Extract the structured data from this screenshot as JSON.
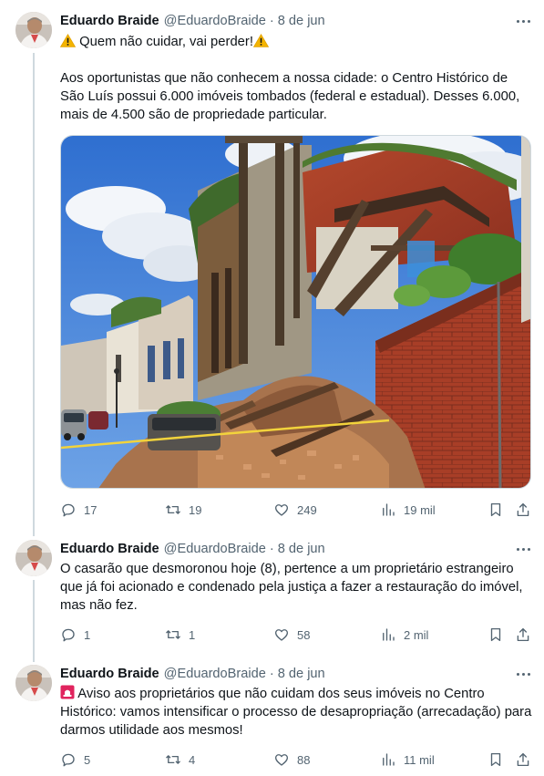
{
  "tweets": [
    {
      "author_name": "Eduardo Braide",
      "handle": "@EduardoBraide",
      "separator": "·",
      "date": "8 de jun",
      "line1": "Quem não cuidar, vai perder!",
      "line1_prefix_emoji": "⚠️",
      "line1_suffix_emoji": "⚠️",
      "paragraph2": "Aos oportunistas que não conhecem a nossa cidade: o Centro Histórico de São Luís possui 6.000 imóveis tombados (federal e estadual). Desses 6.000, mais de 4.500 são de propriedade particular.",
      "stats": {
        "replies": "17",
        "retweets": "19",
        "likes": "249",
        "views": "19 mil"
      }
    },
    {
      "author_name": "Eduardo Braide",
      "handle": "@EduardoBraide",
      "separator": "·",
      "date": "8 de jun",
      "text": "O casarão que desmoronou hoje (8), pertence a um proprietário estrangeiro que já foi acionado e condenado pela justiça a fazer a restauração do imóvel, mas não fez.",
      "stats": {
        "replies": "1",
        "retweets": "1",
        "likes": "58",
        "views": "2 mil"
      }
    },
    {
      "author_name": "Eduardo Braide",
      "handle": "@EduardoBraide",
      "separator": "·",
      "date": "8 de jun",
      "prefix_emoji": "🚨",
      "text": "Aviso aos proprietários que não cuidam dos seus imóveis no Centro Histórico: vamos intensificar o processo de desapropriação (arrecadação) para darmos utilidade aos mesmos!",
      "stats": {
        "replies": "5",
        "retweets": "4",
        "likes": "88",
        "views": "11 mil"
      }
    }
  ],
  "colors": {
    "text": "#0f1419",
    "secondary": "#536471",
    "thread_line": "#cfd9de",
    "warning": "#f4b400",
    "alert": "#e0245e"
  },
  "icons": [
    "reply-icon",
    "retweet-icon",
    "like-icon",
    "views-icon",
    "bookmark-icon",
    "share-icon",
    "more-icon",
    "warning-icon",
    "siren-icon"
  ]
}
